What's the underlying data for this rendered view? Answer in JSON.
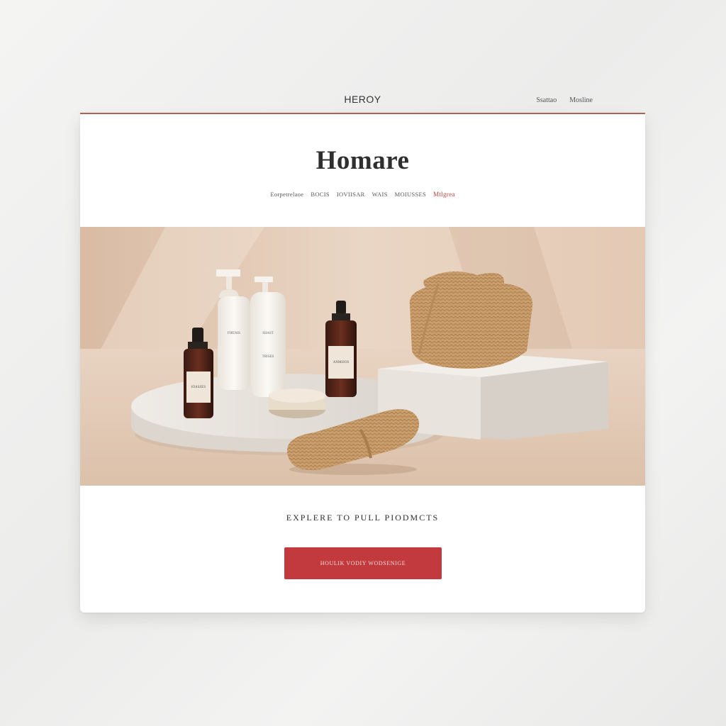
{
  "header": {
    "brand": "HEROY",
    "links": [
      "Ssattao",
      "Mosline"
    ]
  },
  "page": {
    "title": "Homare",
    "nav": [
      {
        "label": "Eorpetrelaoe",
        "active": false
      },
      {
        "label": "BOCIS",
        "active": false
      },
      {
        "label": "IOVIISAR",
        "active": false
      },
      {
        "label": "WAIS",
        "active": false
      },
      {
        "label": "MOIUSSES",
        "active": false
      },
      {
        "label": "Mtlgrea",
        "active": true
      }
    ]
  },
  "hero": {
    "image": "skincare-products-still-life",
    "bottle_labels": [
      "IOASSES",
      "FIRTAIS",
      "ISIAST",
      "ANMSIOS",
      "TRISES"
    ]
  },
  "cta": {
    "explore_text": "EXPLERE TO PULL PIODMCTS",
    "button_label": "HOULIK VODIY WODSENIGE"
  },
  "colors": {
    "accent": "#c2393e",
    "rule": "#b0665a",
    "backdrop": "#e7d2c1"
  }
}
